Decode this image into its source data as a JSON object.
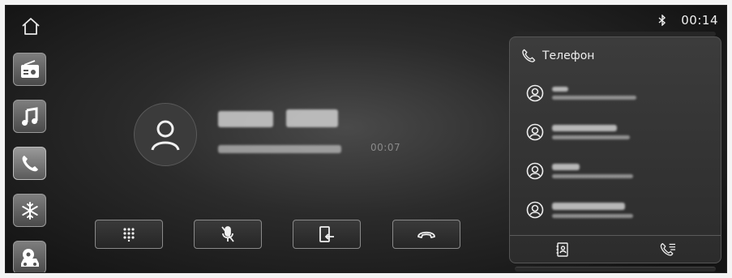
{
  "status": {
    "clock": "00:14",
    "bluetooth_icon": "bluetooth-icon"
  },
  "call": {
    "duration": "00:07"
  },
  "panel": {
    "title": "Телефон"
  },
  "sidebar": {
    "items": [
      {
        "name": "radio-icon"
      },
      {
        "name": "music-icon"
      },
      {
        "name": "phone-icon"
      },
      {
        "name": "climate-icon"
      },
      {
        "name": "car-settings-icon"
      }
    ]
  },
  "controls": [
    "keypad-icon",
    "mute-mic-icon",
    "transfer-to-phone-icon",
    "hang-up-icon"
  ],
  "colors": {
    "background": "#1e1e1e",
    "panel": "#333333",
    "text": "#e6e6e6",
    "muted": "#8a8a8a"
  }
}
